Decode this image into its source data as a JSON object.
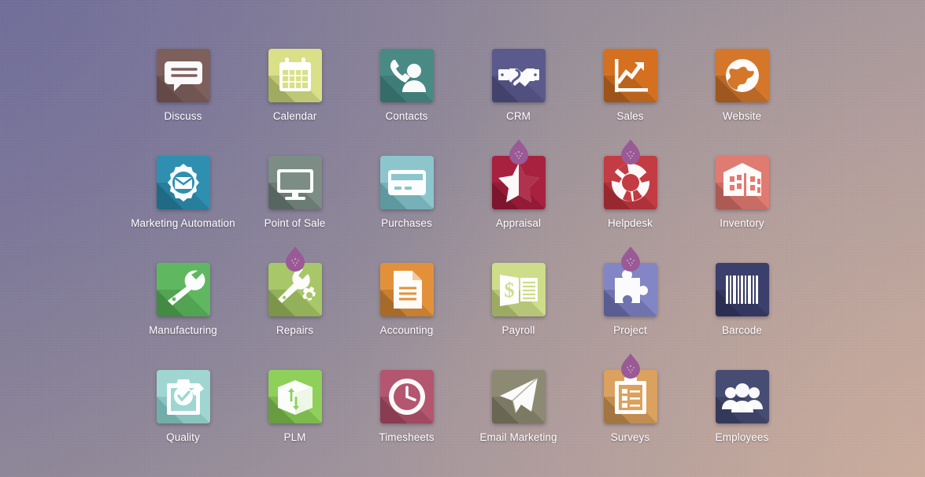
{
  "screen": {
    "name": "app-launcher",
    "background_colors": {
      "top_left": "#857e96",
      "middle": "#99909a",
      "bottom_right": "#b8a0a6"
    }
  },
  "apps": [
    {
      "label": "Discuss",
      "icon": "speech-bubble-icon",
      "bg": "#7d5f5c",
      "shadow": "#5c4341",
      "badge": false
    },
    {
      "label": "Calendar",
      "icon": "calendar-icon",
      "bg": "#d9e087",
      "shadow": "#8d9a53",
      "badge": false
    },
    {
      "label": "Contacts",
      "icon": "phone-person-icon",
      "bg": "#4a8a85",
      "shadow": "#2f6360",
      "badge": false
    },
    {
      "label": "CRM",
      "icon": "handshake-icon",
      "bg": "#5a5b8c",
      "shadow": "#3b3b63",
      "badge": false
    },
    {
      "label": "Sales",
      "icon": "growth-chart-icon",
      "bg": "#d4701f",
      "shadow": "#8b4c18",
      "badge": false
    },
    {
      "label": "Website",
      "icon": "globe-icon",
      "bg": "#d4772a",
      "shadow": "#8a4d1c",
      "badge": false
    },
    {
      "label": "Marketing Automation",
      "icon": "gear-envelope-icon",
      "bg": "#2e8fb0",
      "shadow": "#1d5f77",
      "badge": false
    },
    {
      "label": "Point of Sale",
      "icon": "monitor-icon",
      "bg": "#7c8d86",
      "shadow": "#4b5a55",
      "badge": false
    },
    {
      "label": "Purchases",
      "icon": "credit-card-icon",
      "bg": "#8cc6cc",
      "shadow": "#4f8b91",
      "badge": false
    },
    {
      "label": "Appraisal",
      "icon": "half-star-icon",
      "bg": "#a8213f",
      "shadow": "#6e1229",
      "badge": true
    },
    {
      "label": "Helpdesk",
      "icon": "lifebuoy-icon",
      "bg": "#c33b43",
      "shadow": "#8b2229",
      "badge": true
    },
    {
      "label": "Inventory",
      "icon": "warehouse-icon",
      "bg": "#e07b72",
      "shadow": "#9b4f4a",
      "badge": false
    },
    {
      "label": "Manufacturing",
      "icon": "wrench-icon",
      "bg": "#5fb85f",
      "shadow": "#3a7c3a",
      "badge": false
    },
    {
      "label": "Repairs",
      "icon": "wrench-gear-icon",
      "bg": "#a8c768",
      "shadow": "#6d8440",
      "badge": true
    },
    {
      "label": "Accounting",
      "icon": "document-icon",
      "bg": "#e2913a",
      "shadow": "#935f24",
      "badge": false
    },
    {
      "label": "Payroll",
      "icon": "money-ledger-icon",
      "bg": "#cddd8a",
      "shadow": "#8b9a56",
      "badge": false
    },
    {
      "label": "Project",
      "icon": "puzzle-piece-icon",
      "bg": "#8286c4",
      "shadow": "#4c4f85",
      "badge": true
    },
    {
      "label": "Barcode",
      "icon": "barcode-icon",
      "bg": "#3b3f6b",
      "shadow": "#262948",
      "badge": false
    },
    {
      "label": "Quality",
      "icon": "clipboard-check-icon",
      "bg": "#9fd6d2",
      "shadow": "#63a09c",
      "badge": false
    },
    {
      "label": "PLM",
      "icon": "box-arrows-icon",
      "bg": "#8ed05a",
      "shadow": "#5a8c38",
      "badge": false
    },
    {
      "label": "Timesheets",
      "icon": "clock-icon",
      "bg": "#b4566f",
      "shadow": "#7b3649",
      "badge": false
    },
    {
      "label": "Email Marketing",
      "icon": "paper-plane-icon",
      "bg": "#8d8a73",
      "shadow": "#5d5b4a",
      "badge": false
    },
    {
      "label": "Surveys",
      "icon": "survey-clipboard-icon",
      "bg": "#dba15e",
      "shadow": "#8f6739",
      "badge": true
    },
    {
      "label": "Employees",
      "icon": "people-group-icon",
      "bg": "#474c73",
      "shadow": "#2f3350",
      "badge": false
    }
  ],
  "badge": {
    "name": "enterprise-drop-badge",
    "color": "#9a5a96"
  }
}
